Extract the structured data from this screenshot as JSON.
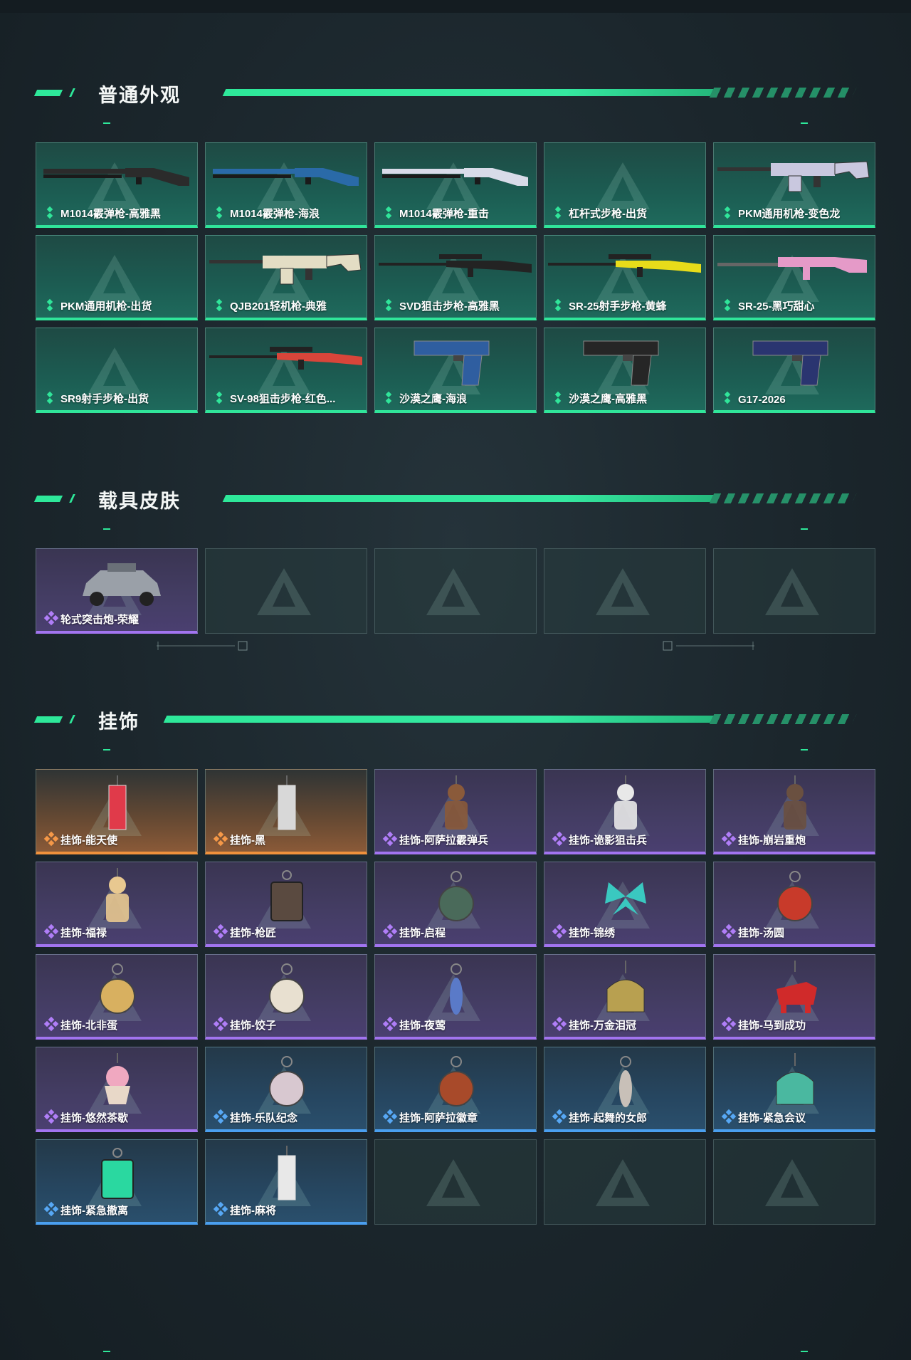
{
  "sections": [
    {
      "title": "普通外观",
      "items": [
        {
          "label": "M1014霰弹枪-高雅黑",
          "rarity": "green",
          "art": "shotgun",
          "color": "#2b2b2b"
        },
        {
          "label": "M1014霰弹枪-海浪",
          "rarity": "green",
          "art": "shotgun",
          "color": "#2a6aa8"
        },
        {
          "label": "M1014霰弹枪-重击",
          "rarity": "green",
          "art": "shotgun",
          "color": "#d8dbe8"
        },
        {
          "label": "杠杆式步枪-出货",
          "rarity": "green",
          "art": "none",
          "color": ""
        },
        {
          "label": "PKM通用机枪-变色龙",
          "rarity": "green",
          "art": "mg",
          "color": "#c9c8df"
        },
        {
          "label": "PKM通用机枪-出货",
          "rarity": "green",
          "art": "none",
          "color": ""
        },
        {
          "label": "QJB201轻机枪-典雅",
          "rarity": "green",
          "art": "mg",
          "color": "#e3ddc4"
        },
        {
          "label": "SVD狙击步枪-高雅黑",
          "rarity": "green",
          "art": "sniper",
          "color": "#232323"
        },
        {
          "label": "SR-25射手步枪-黄蜂",
          "rarity": "green",
          "art": "sniper",
          "color": "#e8dc1a"
        },
        {
          "label": "SR-25-黑巧甜心",
          "rarity": "green",
          "art": "rifle",
          "color": "#e59ac8"
        },
        {
          "label": "SR9射手步枪-出货",
          "rarity": "green",
          "art": "none",
          "color": ""
        },
        {
          "label": "SV-98狙击步枪-红色...",
          "rarity": "green",
          "art": "sniper",
          "color": "#d8453a"
        },
        {
          "label": "沙漠之鹰-海浪",
          "rarity": "green",
          "art": "pistol",
          "color": "#2f5ea0"
        },
        {
          "label": "沙漠之鹰-高雅黑",
          "rarity": "green",
          "art": "pistol",
          "color": "#262626"
        },
        {
          "label": "G17-2026",
          "rarity": "green",
          "art": "pistol",
          "color": "#2a3570"
        }
      ]
    },
    {
      "title": "载具皮肤",
      "items": [
        {
          "label": "轮式突击炮-荣耀",
          "rarity": "purple",
          "art": "vehicle",
          "color": "#9aa0a8"
        },
        {
          "label": "",
          "rarity": "empty",
          "art": "none",
          "color": ""
        },
        {
          "label": "",
          "rarity": "empty",
          "art": "none",
          "color": ""
        },
        {
          "label": "",
          "rarity": "empty",
          "art": "none",
          "color": ""
        },
        {
          "label": "",
          "rarity": "empty",
          "art": "none",
          "color": ""
        }
      ]
    },
    {
      "title": "挂饰",
      "items": [
        {
          "label": "挂饰-能天使",
          "rarity": "orange",
          "art": "tag",
          "color": "#e03a4a"
        },
        {
          "label": "挂饰-黑",
          "rarity": "orange",
          "art": "tag",
          "color": "#d8d8d8"
        },
        {
          "label": "挂饰-阿萨拉霰弹兵",
          "rarity": "purple",
          "art": "figure",
          "color": "#8a5a3a"
        },
        {
          "label": "挂饰-诡影狙击兵",
          "rarity": "purple",
          "art": "figure",
          "color": "#e8e8e8"
        },
        {
          "label": "挂饰-崩岩重炮",
          "rarity": "purple",
          "art": "figure",
          "color": "#6a5040"
        },
        {
          "label": "挂饰-福禄",
          "rarity": "purple",
          "art": "figure",
          "color": "#e8c890"
        },
        {
          "label": "挂饰-枪匠",
          "rarity": "purple",
          "art": "box",
          "color": "#5a4a40"
        },
        {
          "label": "挂饰-启程",
          "rarity": "purple",
          "art": "medal",
          "color": "#4a6a5a"
        },
        {
          "label": "挂饰-锦绣",
          "rarity": "purple",
          "art": "butterfly",
          "color": "#3ac8c0"
        },
        {
          "label": "挂饰-汤圆",
          "rarity": "purple",
          "art": "medal",
          "color": "#c83a2a"
        },
        {
          "label": "挂饰-北非蛋",
          "rarity": "purple",
          "art": "medal",
          "color": "#d8b060"
        },
        {
          "label": "挂饰-饺子",
          "rarity": "purple",
          "art": "medal",
          "color": "#e8e0d0"
        },
        {
          "label": "挂饰-夜莺",
          "rarity": "purple",
          "art": "feather",
          "color": "#5a7ac8"
        },
        {
          "label": "挂饰-万金泪冠",
          "rarity": "purple",
          "art": "crown",
          "color": "#b8a050"
        },
        {
          "label": "挂饰-马到成功",
          "rarity": "purple",
          "art": "horse",
          "color": "#d02a2a"
        },
        {
          "label": "挂饰-悠然茶歇",
          "rarity": "purple",
          "art": "cake",
          "color": "#f0a8c0"
        },
        {
          "label": "挂饰-乐队纪念",
          "rarity": "blue",
          "art": "medal",
          "color": "#d8c8d0"
        },
        {
          "label": "挂饰-阿萨拉徽章",
          "rarity": "blue",
          "art": "medal",
          "color": "#a84a2a"
        },
        {
          "label": "挂饰-起舞的女郎",
          "rarity": "blue",
          "art": "feather",
          "color": "#c8c0b8"
        },
        {
          "label": "挂饰-紧急会议",
          "rarity": "blue",
          "art": "crown",
          "color": "#4ab8a0"
        },
        {
          "label": "挂饰-紧急撤离",
          "rarity": "blue",
          "art": "box",
          "color": "#2ad8a0"
        },
        {
          "label": "挂饰-麻将",
          "rarity": "blue",
          "art": "tag",
          "color": "#e8e8e8"
        },
        {
          "label": "",
          "rarity": "empty",
          "art": "none",
          "color": ""
        },
        {
          "label": "",
          "rarity": "empty",
          "art": "none",
          "color": ""
        },
        {
          "label": "",
          "rarity": "empty",
          "art": "none",
          "color": ""
        }
      ]
    }
  ]
}
